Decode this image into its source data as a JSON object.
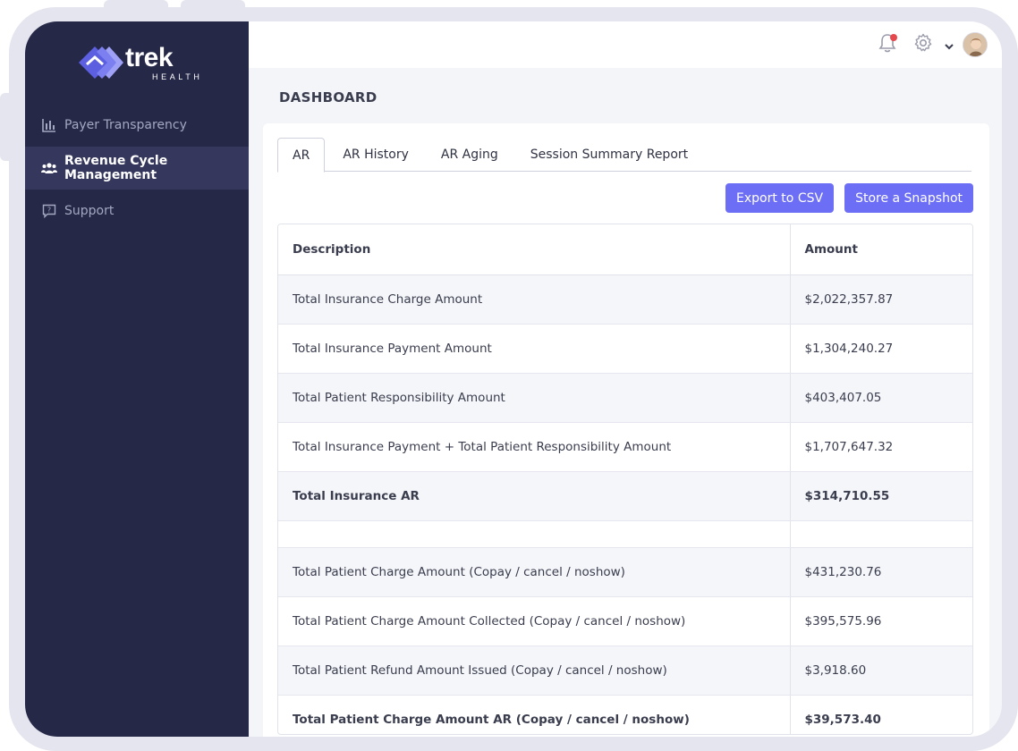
{
  "brand": {
    "name": "trek",
    "sub": "HEALTH"
  },
  "sidebar": {
    "items": [
      {
        "label": "Payer Transparency",
        "icon": "bar-chart-icon",
        "active": false
      },
      {
        "label": "Revenue Cycle Management",
        "icon": "users-icon",
        "active": true
      },
      {
        "label": "Support",
        "icon": "help-chat-icon",
        "active": false
      }
    ]
  },
  "topbar": {
    "notification_icon": "bell-icon",
    "settings_icon": "gear-icon",
    "dropdown_icon": "chevron-down-icon"
  },
  "page": {
    "title": "DASHBOARD"
  },
  "tabs": [
    {
      "label": "AR",
      "active": true
    },
    {
      "label": "AR History",
      "active": false
    },
    {
      "label": "AR Aging",
      "active": false
    },
    {
      "label": "Session Summary Report",
      "active": false
    }
  ],
  "actions": {
    "export_label": "Export to CSV",
    "snapshot_label": "Store a Snapshot"
  },
  "table": {
    "headers": {
      "description": "Description",
      "amount": "Amount"
    },
    "rows": [
      {
        "description": "Total Insurance Charge Amount",
        "amount": "$2,022,357.87"
      },
      {
        "description": "Total Insurance Payment Amount",
        "amount": "$1,304,240.27"
      },
      {
        "description": "Total Patient Responsibility Amount",
        "amount": "$403,407.05"
      },
      {
        "description": "Total Insurance Payment + Total Patient Responsibility Amount",
        "amount": "$1,707,647.32"
      },
      {
        "description": "Total Insurance AR",
        "amount": "$314,710.55"
      },
      {
        "description": "",
        "amount": ""
      },
      {
        "description": "Total Patient Charge Amount (Copay / cancel / noshow)",
        "amount": "$431,230.76"
      },
      {
        "description": "Total Patient Charge Amount Collected (Copay / cancel / noshow)",
        "amount": "$395,575.96"
      },
      {
        "description": "Total Patient Refund Amount Issued (Copay / cancel / noshow)",
        "amount": "$3,918.60"
      },
      {
        "description": "Total Patient Charge Amount AR (Copay / cancel / noshow)",
        "amount": "$39,573.40"
      }
    ]
  },
  "colors": {
    "sidebar": "#262848",
    "accent": "#6c6ef5",
    "notification": "#e5484d"
  }
}
